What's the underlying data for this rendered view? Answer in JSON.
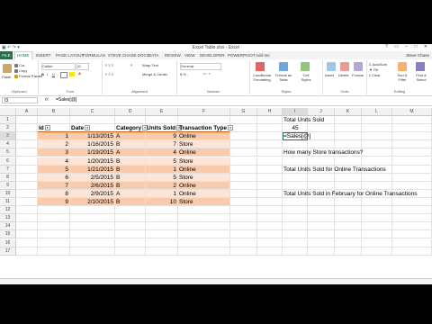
{
  "window": {
    "title": "Excel Table.xlsx - Excel"
  },
  "tabs": {
    "file": "FILE",
    "items": [
      "HOME",
      "INSERT",
      "PAGE LAYOUT",
      "FORMULAS",
      "STEVE CHASE DOCS",
      "DATA",
      "REVIEW",
      "VIEW",
      "DEVELOPER",
      "POWERPIVOT",
      "Add-Ins"
    ],
    "user": "Steve Chase"
  },
  "ribbon": {
    "clipboard": {
      "label": "Clipboard",
      "paste": "Paste",
      "cut": "Cut",
      "copy": "Copy",
      "painter": "Format Painter"
    },
    "font": {
      "label": "Font",
      "name": "Calibri",
      "size": "11"
    },
    "alignment": {
      "label": "Alignment",
      "wrap": "Wrap Text",
      "merge": "Merge & Center"
    },
    "number": {
      "label": "Number",
      "format": "General"
    },
    "styles": {
      "label": "Styles",
      "conditional": "Conditional Formatting",
      "format_table": "Format as Table",
      "cell_styles": "Cell Styles"
    },
    "cells": {
      "label": "Cells",
      "insert": "Insert",
      "delete": "Delete",
      "format": "Format"
    },
    "editing": {
      "label": "Editing",
      "autosum": "AutoSum",
      "fill": "Fill",
      "clear": "Clear",
      "sort": "Sort & Filter",
      "find": "Find & Select"
    }
  },
  "formula_bar": {
    "name_box": "I3",
    "fx": "fx",
    "formula": "=Sales[@]"
  },
  "columns": [
    "A",
    "B",
    "C",
    "D",
    "E",
    "F",
    "G",
    "H",
    "I",
    "J",
    "K",
    "L",
    "M"
  ],
  "rows": [
    "1",
    "2",
    "3",
    "4",
    "5",
    "6",
    "7",
    "8",
    "9",
    "10",
    "11",
    "12",
    "13",
    "14",
    "15",
    "16",
    "17"
  ],
  "table": {
    "headers": [
      "Id",
      "Date",
      "Category",
      "Units Sold",
      "Transaction Type"
    ],
    "rows": [
      [
        "1",
        "1/13/2015",
        "A",
        "9",
        "Online"
      ],
      [
        "2",
        "1/16/2015",
        "B",
        "7",
        "Store"
      ],
      [
        "3",
        "1/19/2015",
        "A",
        "4",
        "Online"
      ],
      [
        "4",
        "1/20/2015",
        "B",
        "5",
        "Store"
      ],
      [
        "5",
        "1/21/2015",
        "B",
        "1",
        "Online"
      ],
      [
        "6",
        "2/5/2015",
        "B",
        "5",
        "Store"
      ],
      [
        "7",
        "2/6/2015",
        "B",
        "2",
        "Online"
      ],
      [
        "8",
        "2/9/2015",
        "A",
        "1",
        "Online"
      ],
      [
        "9",
        "2/10/2015",
        "B",
        "10",
        "Store"
      ]
    ]
  },
  "side": {
    "total_units_label": "Total Units Sold",
    "total_units_value": "45",
    "active_cell_text": "=Sales[@]",
    "store_question": "How many Store transactions?",
    "online_label": "Total Units Sold for Online Transactions",
    "feb_label": "Total Units Sold in February for Online Transactions"
  }
}
